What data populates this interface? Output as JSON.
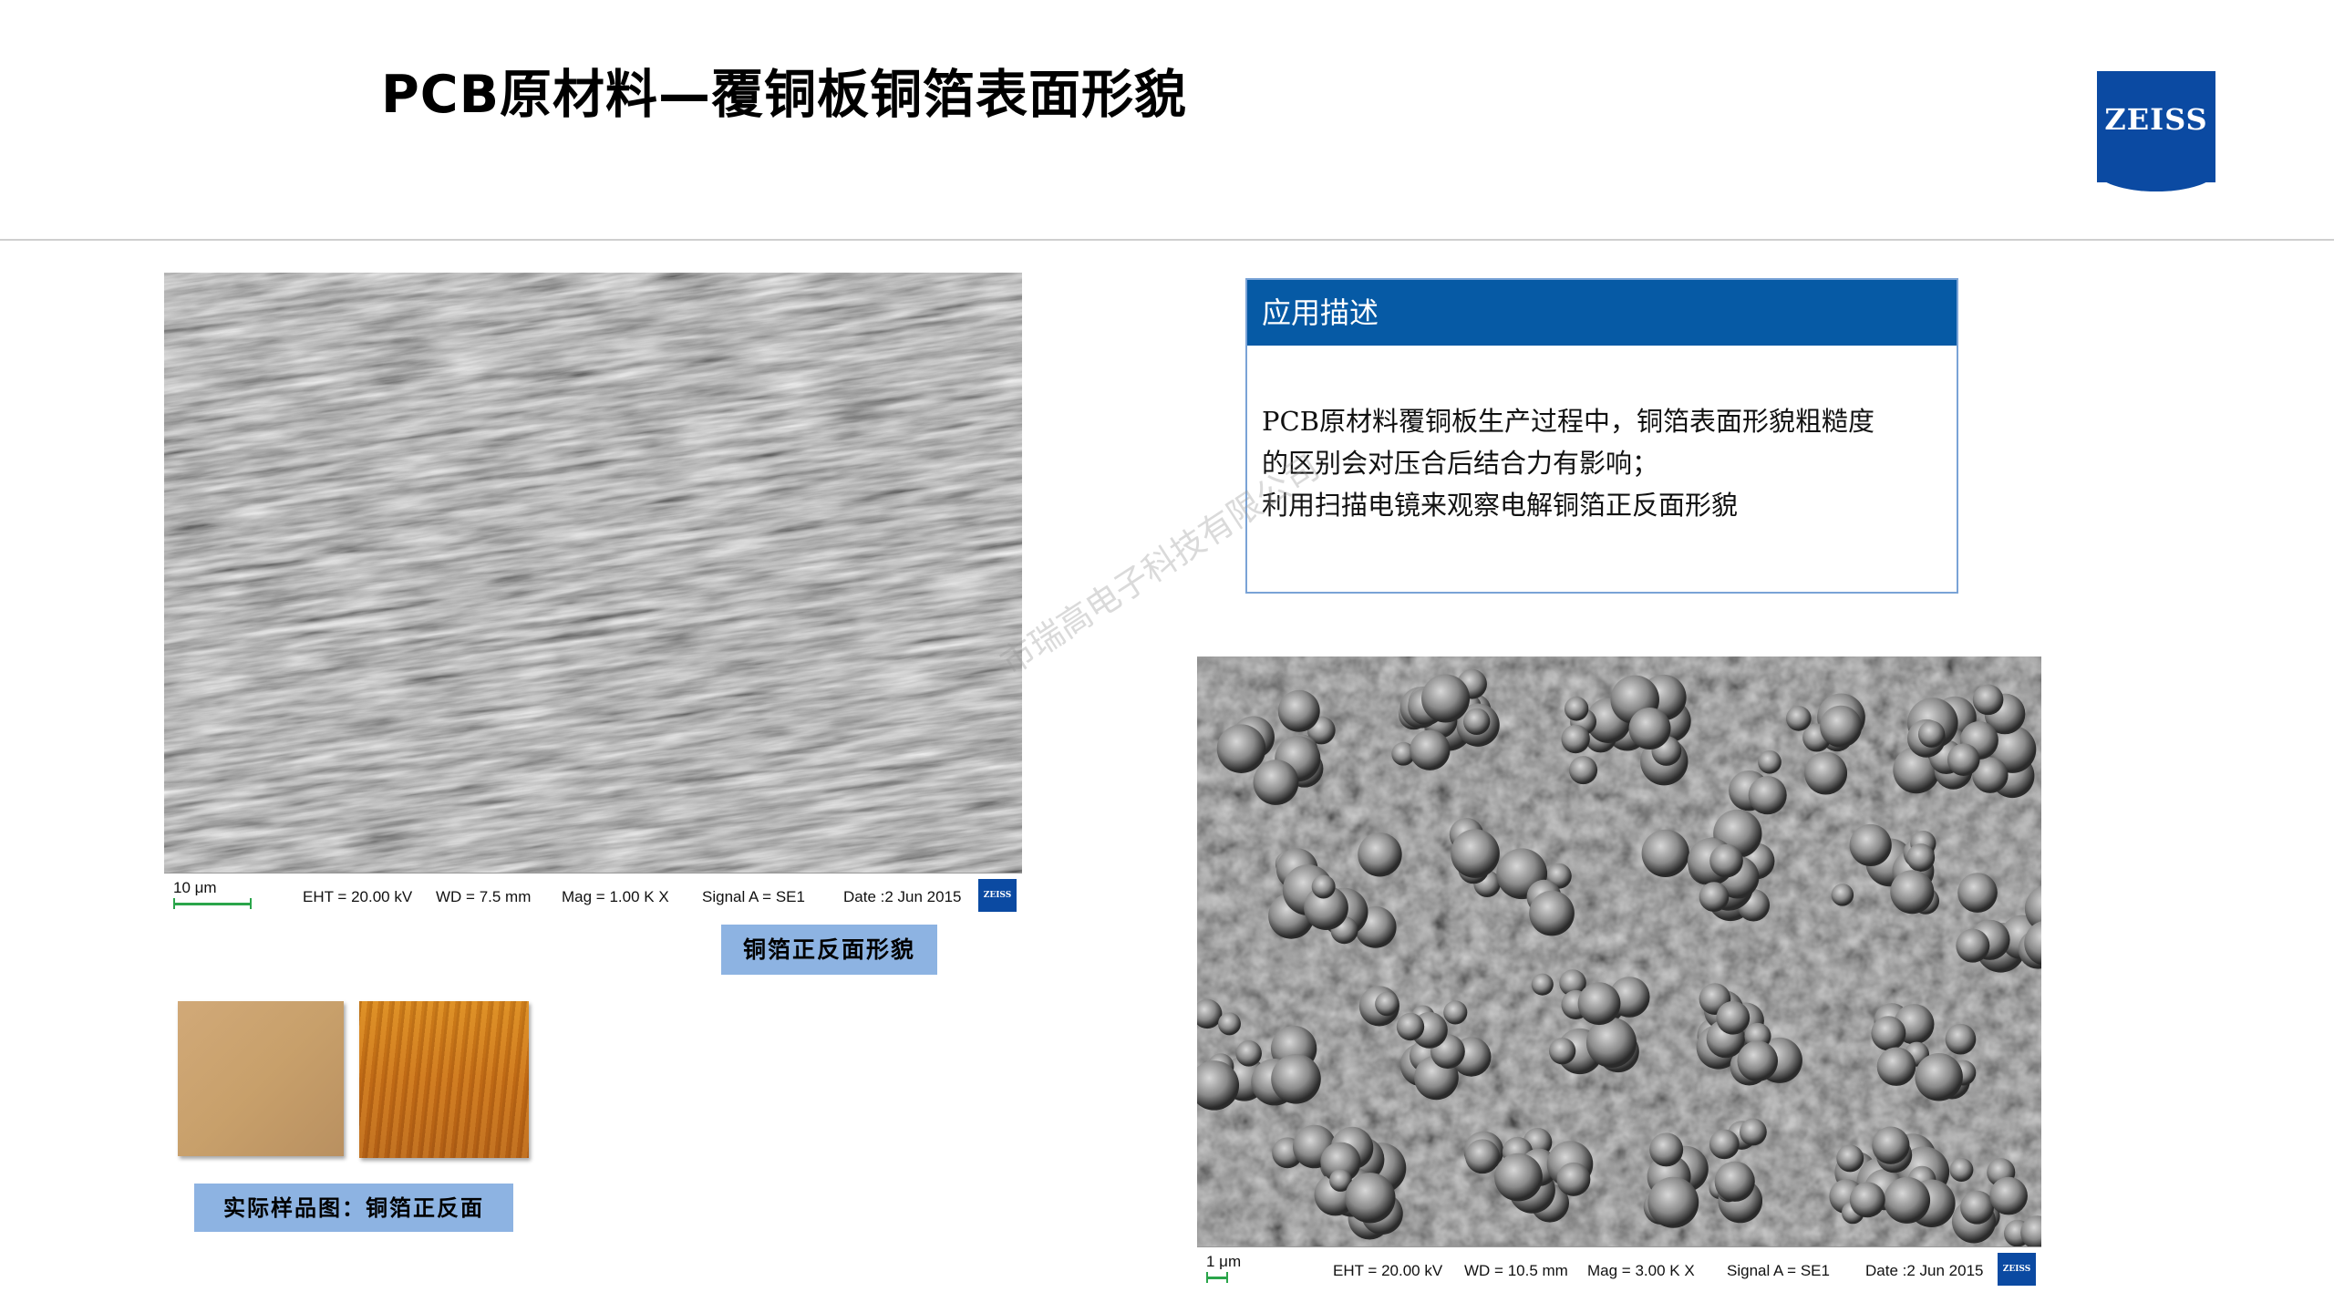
{
  "header": {
    "title": "PCB原材料—覆铜板铜箔表面形貌",
    "logo_text": "ZEISS"
  },
  "sem_top": {
    "scale": "10 μm",
    "eht": "EHT = 20.00 kV",
    "wd": "WD =  7.5 mm",
    "mag": "Mag =   1.00 K X",
    "signal": "Signal A = SE1",
    "date": "Date :2 Jun 2015",
    "logo_text": "ZEISS"
  },
  "caption_top": "铜箔正反面形貌",
  "samples": {
    "caption": "实际样品图：铜箔正反面"
  },
  "description": {
    "heading": "应用描述",
    "lines": [
      "PCB原材料覆铜板生产过程中，铜箔表面形貌粗糙度",
      "的区别会对压合后结合力有影响；",
      "利用扫描电镜来观察电解铜箔正反面形貌"
    ]
  },
  "sem_bottom": {
    "scale": "1 μm",
    "eht": "EHT = 20.00 kV",
    "wd": "WD = 10.5 mm",
    "mag": "Mag =   3.00 K X",
    "signal": "Signal A = SE1",
    "date": "Date :2 Jun 2015",
    "logo_text": "ZEISS"
  },
  "watermark": "市瑞高电子科技有限公司",
  "colors": {
    "brand_blue": "#065aa5",
    "caption_blue": "#8db3e2"
  }
}
